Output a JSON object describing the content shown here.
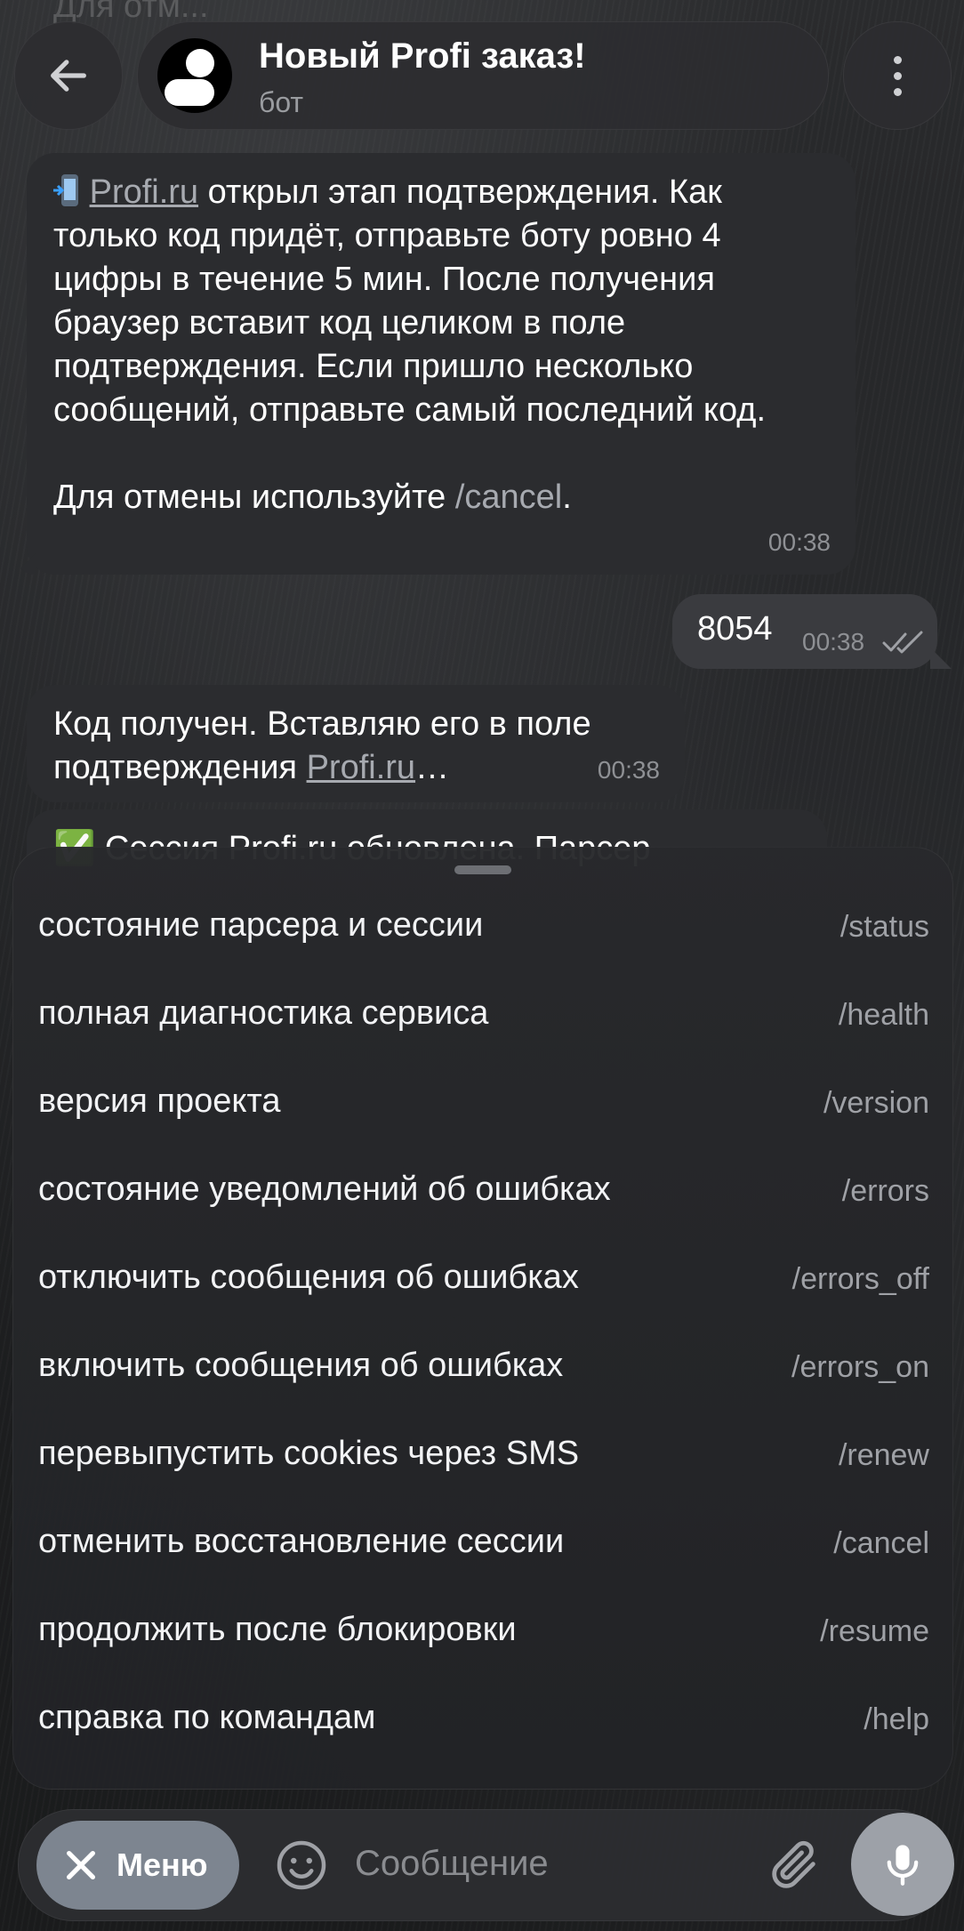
{
  "background_hint_text": "Для отм...",
  "header": {
    "title": "Новый Profi заказ!",
    "subtitle": "бот"
  },
  "messages": [
    {
      "id": "m1",
      "direction": "in",
      "parts": {
        "link": "Profi.ru",
        "text1": " открыл этап подтверждения. Как только код придёт, отправьте боту ровно 4 цифры в течение 5 мин. После получения браузер вставит код целиком в поле подтверждения. Если пришло несколько сообщений, отправьте самый последний код.",
        "text2": "Для отмены используйте ",
        "cmd": "/cancel",
        "text3": "."
      },
      "time": "00:38"
    },
    {
      "id": "m2",
      "direction": "out",
      "text": "8054",
      "time": "00:38",
      "status": "read"
    },
    {
      "id": "m3",
      "direction": "in",
      "parts": {
        "text1": "Код получен. Вставляю его в поле подтверждения ",
        "link": "Profi.ru",
        "text2": "…"
      },
      "time": "00:38"
    },
    {
      "id": "m4",
      "direction": "in",
      "partial_text": "✅ Сессия Profi.ru обновлена. Парсер"
    }
  ],
  "commands": [
    {
      "desc": "состояние парсера и сессии",
      "cmd": "/status"
    },
    {
      "desc": "полная диагностика сервиса",
      "cmd": "/health"
    },
    {
      "desc": "версия проекта",
      "cmd": "/version"
    },
    {
      "desc": "состояние уведомлений об ошибках",
      "cmd": "/errors"
    },
    {
      "desc": "отключить сообщения об ошибках",
      "cmd": "/errors_off"
    },
    {
      "desc": "включить сообщения об ошибках",
      "cmd": "/errors_on"
    },
    {
      "desc": "перевыпустить cookies через SMS",
      "cmd": "/renew"
    },
    {
      "desc": "отменить восстановление сессии",
      "cmd": "/cancel"
    },
    {
      "desc": "продолжить после блокировки",
      "cmd": "/resume"
    },
    {
      "desc": "справка по командам",
      "cmd": "/help"
    }
  ],
  "input": {
    "menu_label": "Меню",
    "placeholder": "Сообщение"
  },
  "icons": {
    "back": "arrow-left-icon",
    "more": "more-vertical-icon",
    "close": "close-icon",
    "emoji": "emoji-icon",
    "attach": "paperclip-icon",
    "mic": "microphone-icon",
    "read": "double-check-icon",
    "phone": "mobile-phone-arrow-icon"
  },
  "colors": {
    "bubble_in": "#2b2c2f",
    "bubble_out": "#3a3b3f",
    "menu_pill": "#7d8590",
    "mic_button": "#9da1a8",
    "link": "#a7aab0"
  }
}
